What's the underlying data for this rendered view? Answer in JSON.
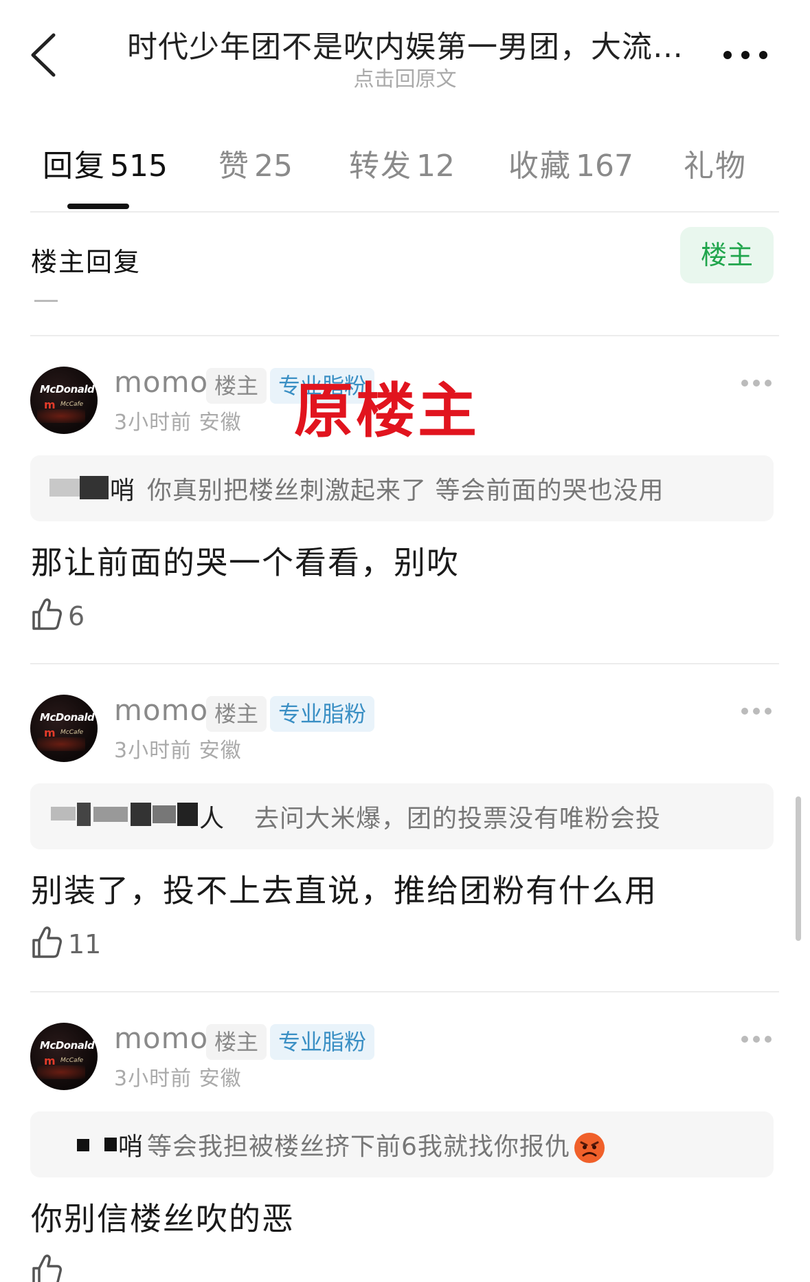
{
  "header": {
    "title": "时代少年团不是吹内娱第一男团，大流…",
    "subtitle": "点击回原文",
    "back_icon": "chevron-left-icon",
    "more_icon": "more-horizontal-icon"
  },
  "tabs": [
    {
      "label": "回复",
      "count": "515",
      "active": true
    },
    {
      "label": "赞",
      "count": "25",
      "active": false
    },
    {
      "label": "转发",
      "count": "12",
      "active": false
    },
    {
      "label": "收藏",
      "count": "167",
      "active": false
    },
    {
      "label": "礼物",
      "count": "",
      "active": false
    }
  ],
  "section": {
    "title": "楼主回复",
    "filter_label": "楼主"
  },
  "stamp_text": "原楼主",
  "comments": [
    {
      "username": "momo",
      "owner_tag": "楼主",
      "fan_tag": "专业脂粉",
      "meta": "3小时前 安徽",
      "quote_user_tail": "哨",
      "quote_text": "你真别把楼丝刺激起来了 等会前面的哭也没用",
      "reply": "那让前面的哭一个看看，别吹",
      "likes": "6"
    },
    {
      "username": "momo",
      "owner_tag": "楼主",
      "fan_tag": "专业脂粉",
      "meta": "3小时前 安徽",
      "quote_user_tail": "人",
      "quote_text": "去问大米爆，团的投票没有唯粉会投",
      "reply": "别装了，投不上去直说，推给团粉有什么用",
      "likes": "11"
    },
    {
      "username": "momo",
      "owner_tag": "楼主",
      "fan_tag": "专业脂粉",
      "meta": "3小时前 安徽",
      "quote_user_tail": "哨",
      "quote_text": "等会我担被楼丝挤下前6我就找你报仇",
      "reply": "你别信楼丝吹的恶",
      "likes": ""
    }
  ],
  "colors": {
    "accent_green": "#20a54c",
    "fan_tag_blue": "#3a8fc4",
    "stamp_red": "#e1141e"
  }
}
